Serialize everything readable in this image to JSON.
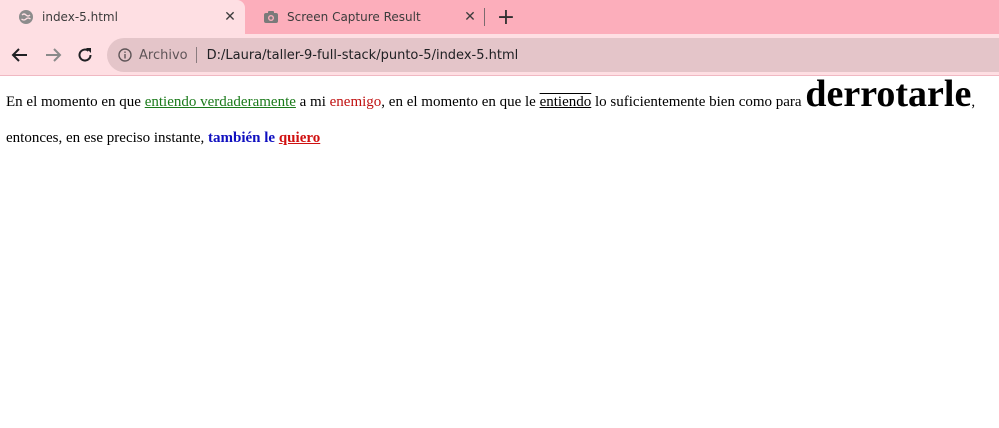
{
  "browser": {
    "tabs": [
      {
        "title": "index-5.html",
        "icon": "globe-icon",
        "active": true
      },
      {
        "title": "Screen Capture Result",
        "icon": "camera-icon",
        "active": false
      }
    ],
    "new_tab": "+",
    "close": "✕",
    "address_bar": {
      "scheme_label": "Archivo",
      "url": "D:/Laura/taller-9-full-stack/punto-5/index-5.html"
    },
    "colors": {
      "tabstrip": "#fcaebb",
      "toolbar": "#fedfe3",
      "omnibox": "#e4c5c9"
    }
  },
  "page": {
    "segments": [
      {
        "text": "En el momento en que ",
        "style": "plain"
      },
      {
        "text": "entiendo verdaderamente",
        "style": "green-underline"
      },
      {
        "text": " a mi ",
        "style": "plain"
      },
      {
        "text": "enemigo",
        "style": "red"
      },
      {
        "text": ", en el momento en que le ",
        "style": "plain"
      },
      {
        "text": "entiendo",
        "style": "overline-underline"
      },
      {
        "text": " lo suficientemente bien como para ",
        "style": "plain"
      },
      {
        "text": "derrotarle",
        "style": "big-bold"
      },
      {
        "text": ", entonces, en ese preciso instante, ",
        "style": "plain"
      },
      {
        "text": "también le",
        "style": "blue-bold"
      },
      {
        "text": " ",
        "style": "plain"
      },
      {
        "text": "quiero",
        "style": "red-bold-underline"
      }
    ],
    "colors": {
      "green": "#1a7a1a",
      "red": "#c01010",
      "blue": "#1010c0"
    }
  }
}
